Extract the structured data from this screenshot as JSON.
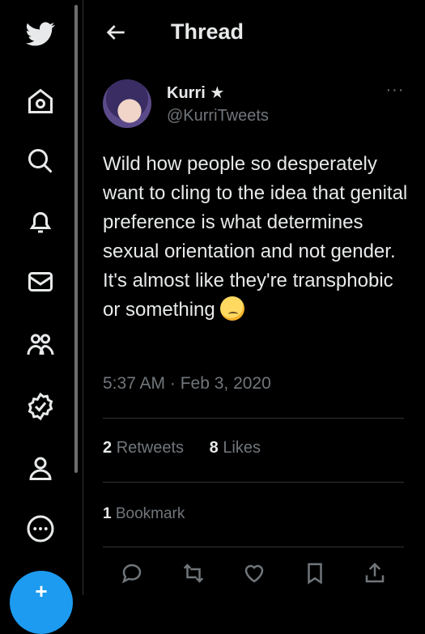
{
  "sidebar": {
    "items": [
      {
        "icon": "twitter-bird-icon"
      },
      {
        "icon": "home-icon"
      },
      {
        "icon": "search-icon"
      },
      {
        "icon": "bell-icon"
      },
      {
        "icon": "mail-icon"
      },
      {
        "icon": "communities-icon"
      },
      {
        "icon": "verified-icon"
      },
      {
        "icon": "profile-icon"
      },
      {
        "icon": "more-circle-icon"
      }
    ],
    "compose_glyph": "+"
  },
  "header": {
    "title": "Thread",
    "back_icon": "arrow-left-icon"
  },
  "tweet": {
    "author_name": "Kurri",
    "author_badge": "★",
    "handle": "@KurriTweets",
    "text": "Wild how people so desperately want to cling to the idea that genital preference is what determines sexual orientation and not gender. It's almost like they're transphobic or something",
    "time": "5:37 AM · Feb 3, 2020",
    "retweets_count": "2",
    "retweets_label": "Retweets",
    "likes_count": "8",
    "likes_label": "Likes",
    "bookmarks_count": "1",
    "bookmarks_label": "Bookmark",
    "more_glyph": "···"
  },
  "colors": {
    "accent": "#1d9bf0",
    "text": "#e7e9ea",
    "muted": "#71767b",
    "border": "#2f3336"
  }
}
